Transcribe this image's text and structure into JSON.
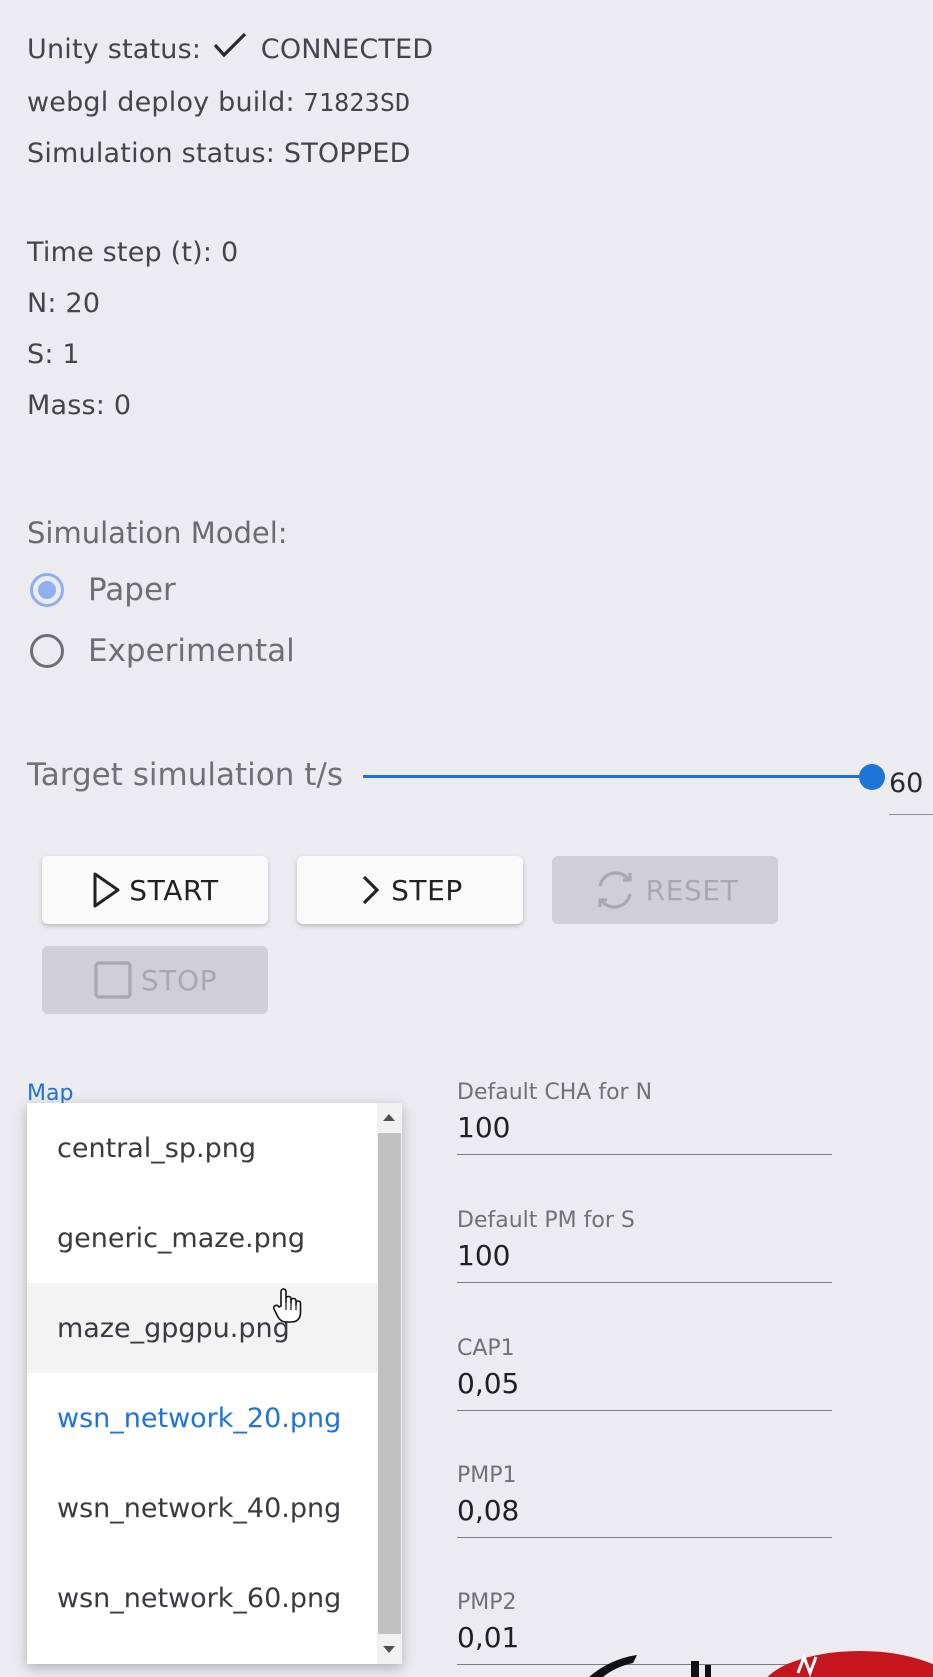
{
  "status": {
    "unity_label": "Unity status:",
    "unity_value": "CONNECTED",
    "build_label": "webgl deploy build:",
    "build_value": "71823SD",
    "sim_label": "Simulation status:",
    "sim_value": "STOPPED"
  },
  "stats": {
    "timestep": "Time step (t): 0",
    "n": "N: 20",
    "s": "S: 1",
    "mass": "Mass: 0"
  },
  "model": {
    "label": "Simulation Model:",
    "options": [
      {
        "label": "Paper",
        "checked": true
      },
      {
        "label": "Experimental",
        "checked": false
      }
    ]
  },
  "slider": {
    "label": "Target simulation t/s",
    "value": "60",
    "fraction": 1.0,
    "accent_color": "#1e74d6"
  },
  "buttons": {
    "start": "START",
    "step": "STEP",
    "reset": "RESET",
    "stop": "STOP"
  },
  "map": {
    "label": "Map",
    "options": [
      "central_sp.png",
      "generic_maze.png",
      "maze_gpgpu.png",
      "wsn_network_20.png",
      "wsn_network_40.png",
      "wsn_network_60.png"
    ],
    "hovered": "maze_gpgpu.png",
    "selected": "wsn_network_20.png"
  },
  "fields": [
    {
      "label": "Default CHA for N",
      "value": "100"
    },
    {
      "label": "Default PM for S",
      "value": "100"
    },
    {
      "label": "CAP1",
      "value": "0,05"
    },
    {
      "label": "PMP1",
      "value": "0,08"
    },
    {
      "label": "PMP2",
      "value": "0,01"
    }
  ],
  "icons": {
    "check": "check-icon",
    "play": "play-icon",
    "chevron": "chevron-right-icon",
    "sync": "sync-icon",
    "stop": "stop-icon",
    "cursor": "hand-pointer-icon"
  }
}
